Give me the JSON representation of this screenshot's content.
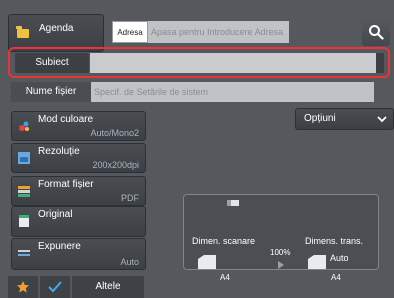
{
  "header": {
    "agenda_label": "Agenda",
    "adresa_label": "Adresa",
    "adresa_placeholder": "Apasa pentru Introducere Adresa"
  },
  "subject": {
    "label": "Subiect",
    "value": ""
  },
  "file_name": {
    "label": "Nume fișier",
    "placeholder": "Specif. de Setările de sistem"
  },
  "options_label": "Opțiuni",
  "settings": {
    "color_mode": {
      "title": "Mod culoare",
      "value": "Auto/Mono2"
    },
    "resolution": {
      "title": "Rezoluție",
      "value": "200x200dpi"
    },
    "file_format": {
      "title": "Format fișier",
      "value": "PDF"
    },
    "original": {
      "title": "Original",
      "value": ""
    },
    "exposure": {
      "title": "Expunere",
      "value": "Auto"
    }
  },
  "preview": {
    "scan_size_label": "Dimen. scanare",
    "send_size_label": "Dimens. trans.",
    "zoom": "100%",
    "scan_paper": "A4",
    "send_paper": "A4",
    "send_auto": "Auto"
  },
  "bottom": {
    "other_label": "Altele"
  },
  "colors": {
    "highlight": "#e8343a",
    "background": "#55595e",
    "value_text": "#aab3c0"
  }
}
